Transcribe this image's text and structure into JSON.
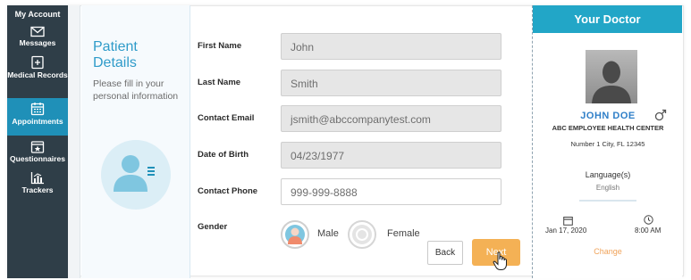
{
  "sidebar": {
    "account": "My Account",
    "items": [
      {
        "label": "Messages",
        "icon": "envelope-icon",
        "active": false
      },
      {
        "label": "Medical Records",
        "icon": "medical-record-icon",
        "active": false
      },
      {
        "label": "Appointments",
        "icon": "calendar-icon",
        "active": true
      },
      {
        "label": "Questionnaires",
        "icon": "star-calendar-icon",
        "active": false
      },
      {
        "label": "Trackers",
        "icon": "chart-icon",
        "active": false
      }
    ]
  },
  "details": {
    "title": "Patient Details",
    "subtitle": "Please fill in your personal information",
    "icon": "patient-form-icon"
  },
  "form": {
    "first_name_label": "First Name",
    "first_name": "John",
    "last_name_label": "Last Name",
    "last_name": "Smith",
    "email_label": "Contact Email",
    "email": "jsmith@abccompanytest.com",
    "dob_label": "Date of Birth",
    "dob": "04/23/1977",
    "phone_label": "Contact Phone",
    "phone": "999-999-8888",
    "gender_label": "Gender",
    "gender_options": [
      "Male",
      "Female"
    ],
    "selected_gender": "Male",
    "back_label": "Back",
    "next_label": "Next"
  },
  "doctor": {
    "header": "Your Doctor",
    "name": "JOHN DOE",
    "gender_icon": "male-symbol-icon",
    "center": "ABC EMPLOYEE HEALTH CENTER",
    "address": "Number 1 City, FL 12345",
    "language_label": "Language(s)",
    "language": "English",
    "date": "Jan 17, 2020",
    "time": "8:00 AM",
    "change_label": "Change"
  },
  "colors": {
    "sidebar_bg": "#2f3e48",
    "active_bg": "#1f90b8",
    "accent": "#2f9bc9",
    "header_bg": "#22a6c7",
    "next_bg": "#f4b155",
    "change_text": "#f0a35a"
  }
}
